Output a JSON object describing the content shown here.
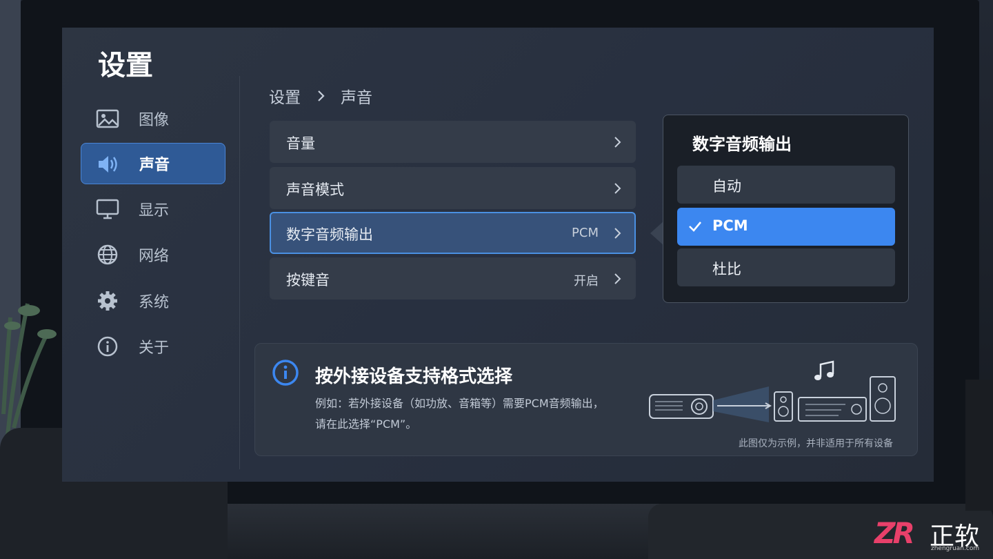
{
  "app": {
    "title": "设置"
  },
  "sidebar": {
    "items": [
      {
        "label": "图像",
        "icon": "image-icon",
        "active": false
      },
      {
        "label": "声音",
        "icon": "speaker-icon",
        "active": true
      },
      {
        "label": "显示",
        "icon": "monitor-icon",
        "active": false
      },
      {
        "label": "网络",
        "icon": "globe-icon",
        "active": false
      },
      {
        "label": "系统",
        "icon": "gear-icon",
        "active": false
      },
      {
        "label": "关于",
        "icon": "info-icon",
        "active": false
      }
    ]
  },
  "breadcrumb": {
    "root": "设置",
    "current": "声音"
  },
  "menu": {
    "items": [
      {
        "label": "音量",
        "value": ""
      },
      {
        "label": "声音模式",
        "value": ""
      },
      {
        "label": "数字音频输出",
        "value": "PCM",
        "selected": true
      },
      {
        "label": "按键音",
        "value": "开启"
      }
    ]
  },
  "popup": {
    "title": "数字音频输出",
    "options": [
      {
        "label": "自动",
        "active": false
      },
      {
        "label": "PCM",
        "active": true
      },
      {
        "label": "杜比",
        "active": false
      }
    ]
  },
  "info": {
    "title": "按外接设备支持格式选择",
    "line1": "例如：若外接设备（如功放、音箱等）需要PCM音频输出，",
    "line2": "请在此选择“PCM”。",
    "caption": "此图仅为示例，并非适用于所有设备"
  },
  "watermark": {
    "logo": "ZR",
    "name": "正软",
    "url": "zhengruan.com"
  },
  "colors": {
    "accent": "#3c87f0",
    "selected_border": "#4a90e2",
    "sidebar_active": "#2f5a96",
    "watermark": "#e8406a"
  }
}
